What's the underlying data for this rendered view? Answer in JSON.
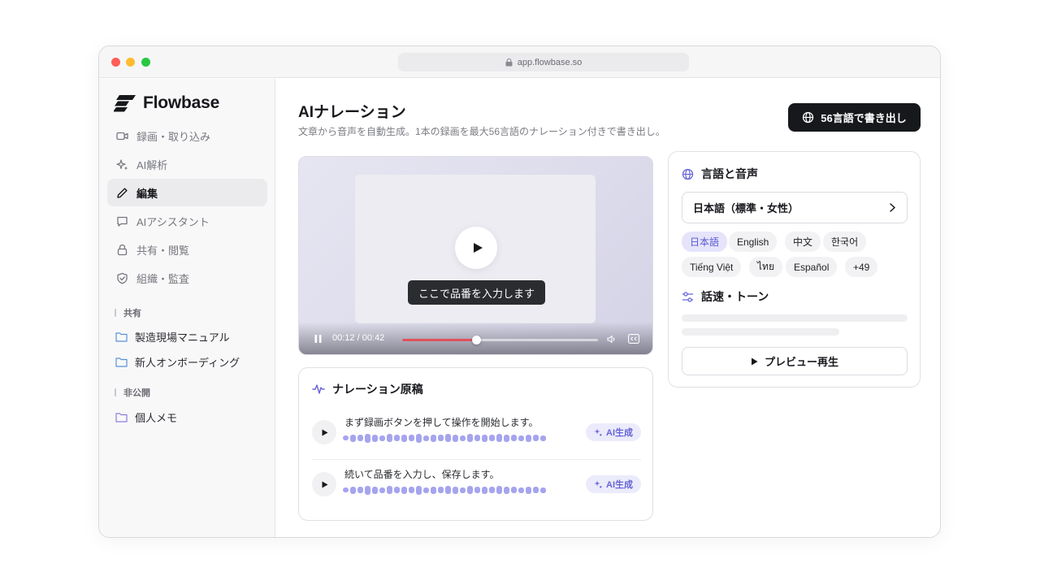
{
  "browser": {
    "url": "app.flowbase.so"
  },
  "sidebar": {
    "brand": "Flowbase",
    "nav": [
      {
        "label": "録画・取り込み",
        "icon": "video-camera-icon"
      },
      {
        "label": "AI解析",
        "icon": "sparkle-icon"
      },
      {
        "label": "編集",
        "icon": "pencil-icon",
        "active": true
      },
      {
        "label": "AIアシスタント",
        "icon": "chat-bubble-icon"
      },
      {
        "label": "共有・閲覧",
        "icon": "lock-icon"
      },
      {
        "label": "組織・監査",
        "icon": "shield-check-icon"
      }
    ],
    "shared_label": "共有",
    "shared_folders": [
      "製造現場マニュアル",
      "新人オンボーディング"
    ],
    "private_label": "非公開",
    "private_folders": [
      "個人メモ"
    ]
  },
  "main": {
    "title": "AIナレーション",
    "subtitle": "文章から音声を自動生成。1本の録画を最大56言語のナレーション付きで書き出し。",
    "export_label": "56言語で書き出し"
  },
  "video": {
    "caption": "ここで品番を入力します",
    "time": "00:12 / 00:42",
    "progress": 0.38
  },
  "script": {
    "title": "ナレーション原稿",
    "lines": [
      {
        "text": "まず録画ボタンを押して操作を開始します。",
        "badge": "AI生成"
      },
      {
        "text": "続いて品番を入力し、保存します。",
        "badge": "AI生成"
      }
    ]
  },
  "language": {
    "title": "言語と音声",
    "selected_voice": "日本語（標準・女性）",
    "chips": [
      "日本語",
      "English",
      "中文",
      "한국어",
      "Tiếng Việt",
      "ไทย",
      "Español",
      "+49"
    ],
    "selected_chip": "日本語",
    "tone_title": "話速・トーン",
    "preview_label": "プレビュー再生"
  },
  "colors": {
    "accent": "#6664d6",
    "primary_button": "#17181c",
    "progress": "#e0525b",
    "waveform": "#a6a4ee"
  }
}
